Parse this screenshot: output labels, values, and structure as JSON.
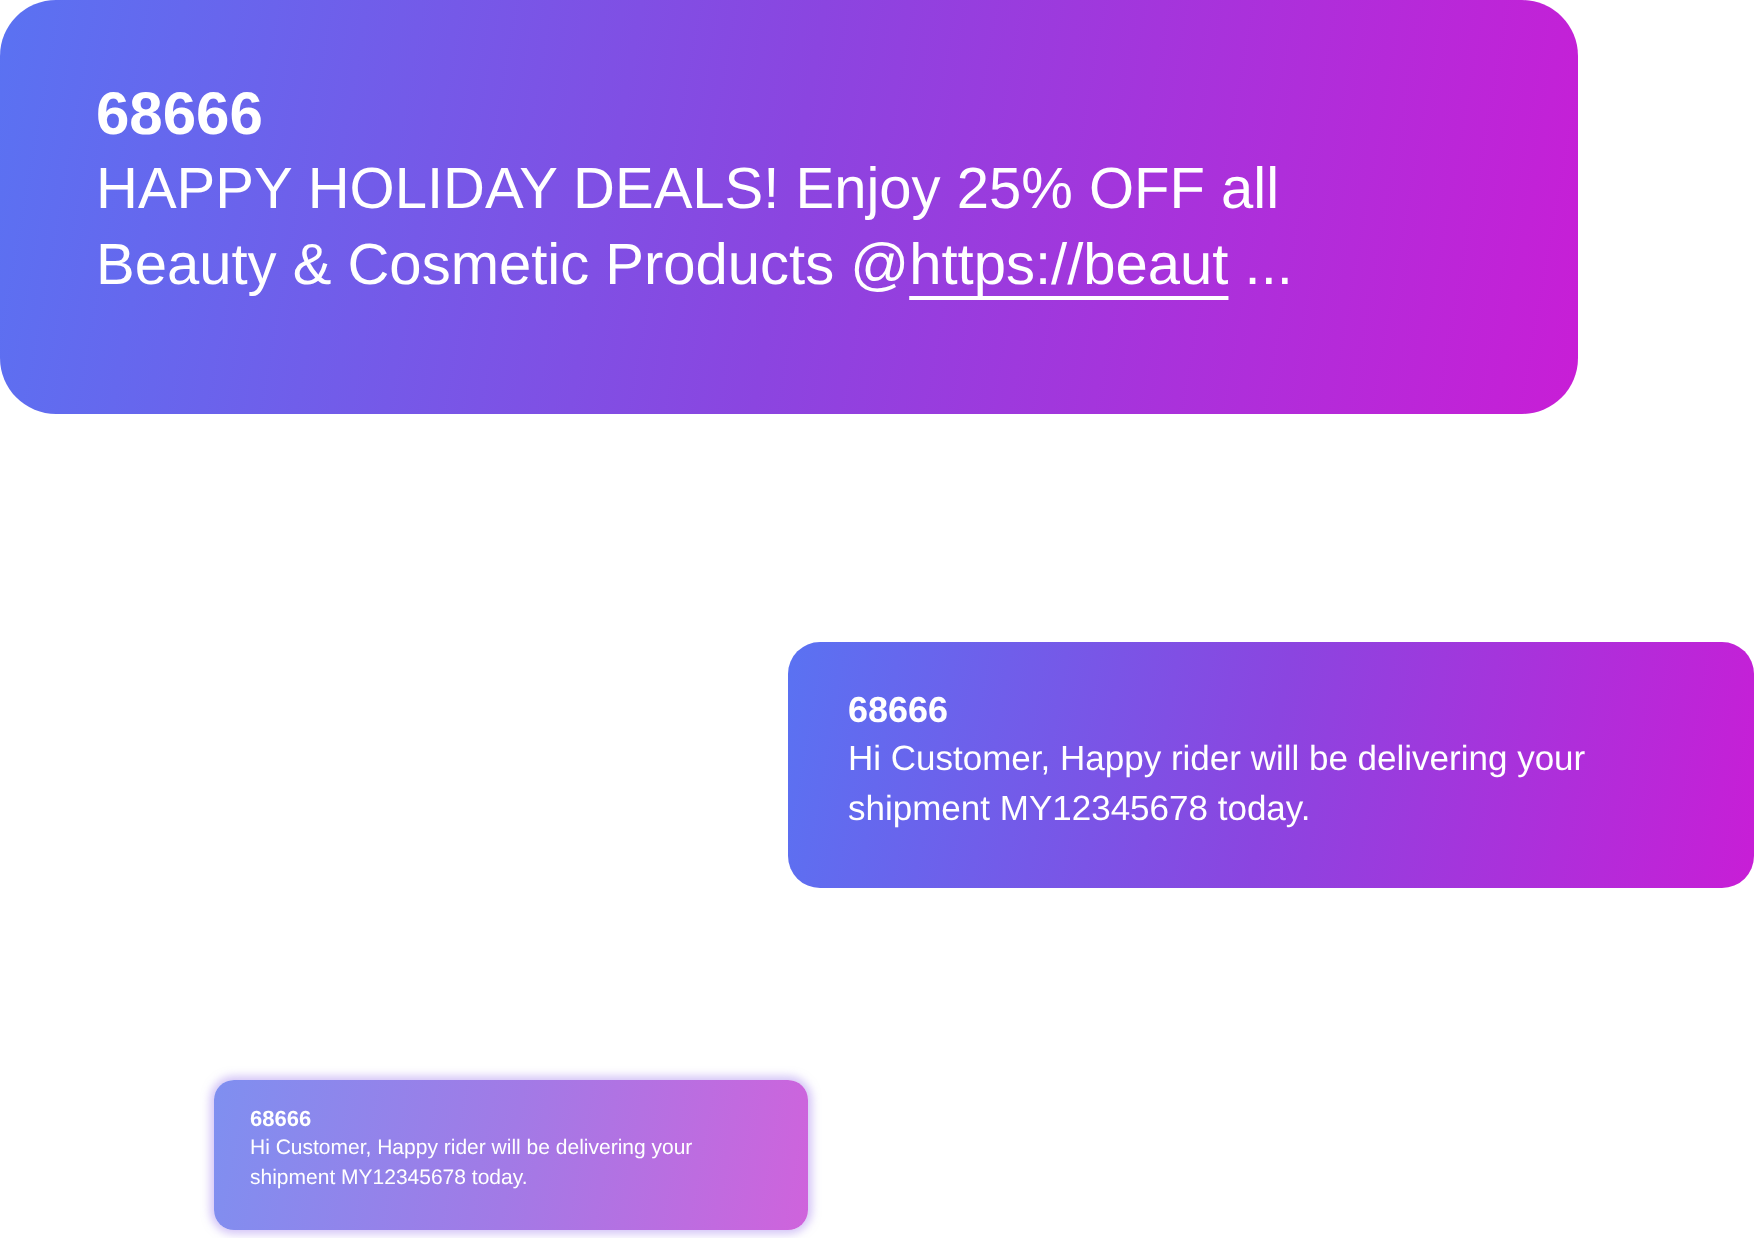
{
  "messages": [
    {
      "sender": "68666",
      "text": "HAPPY HOLIDAY DEALS! Enjoy 25% OFF all Beauty & Cosmetic Products  @",
      "link": "https://beaut",
      "suffix": " ...",
      "blurred": false
    },
    {
      "sender": "68666",
      "text": "Hi Customer, Happy rider will be delivering your shipment MY12345678 today.",
      "blurred": false
    },
    {
      "sender": "68666",
      "text": "Hi Customer, Happy rider will be delivering your shipment MY12345678 today.",
      "blurred": true
    }
  ]
}
